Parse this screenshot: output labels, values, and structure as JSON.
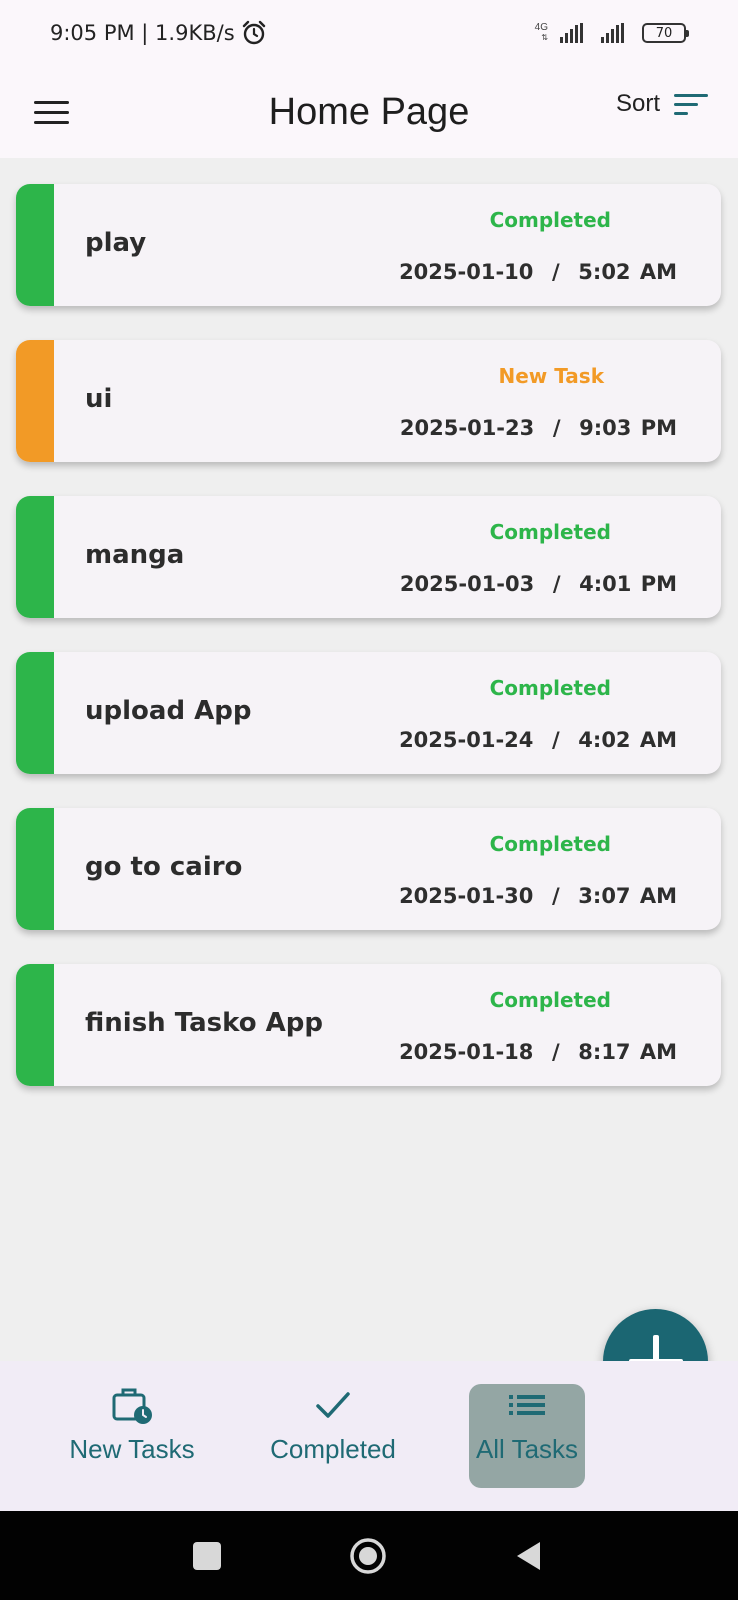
{
  "status_bar": {
    "time_speed": "9:05 PM | 1.9KB/s",
    "alarm_icon": "alarm-clock-icon",
    "network_type": "4G",
    "battery": "70"
  },
  "app_bar": {
    "title": "Home Page",
    "sort_label": "Sort",
    "menu_icon": "hamburger-menu-icon",
    "sort_icon": "sort-lines-icon"
  },
  "colors": {
    "completed": "#2db54a",
    "new_task": "#f29a26",
    "accent": "#1b6672"
  },
  "tasks": [
    {
      "title": "play",
      "status": "Completed",
      "datetime": "2025-01-10  /  5:02 AM",
      "status_type": "completed"
    },
    {
      "title": "ui",
      "status": "New Task",
      "datetime": "2025-01-23  /  9:03 PM",
      "status_type": "new"
    },
    {
      "title": "manga",
      "status": "Completed",
      "datetime": "2025-01-03  /  4:01 PM",
      "status_type": "completed"
    },
    {
      "title": "upload App",
      "status": "Completed",
      "datetime": "2025-01-24  /  4:02 AM",
      "status_type": "completed"
    },
    {
      "title": "go to cairo",
      "status": "Completed",
      "datetime": "2025-01-30  /  3:07 AM",
      "status_type": "completed"
    },
    {
      "title": "finish Tasko App",
      "status": "Completed",
      "datetime": "2025-01-18  /  8:17 AM",
      "status_type": "completed"
    }
  ],
  "fab": {
    "icon": "plus-icon"
  },
  "bottom_nav": {
    "items": [
      {
        "label": "New Tasks",
        "icon": "briefcase-clock-icon"
      },
      {
        "label": "Completed",
        "icon": "checkmark-icon"
      },
      {
        "label": "All Tasks",
        "icon": "list-icon",
        "active": true
      }
    ]
  },
  "system_nav": {
    "recents_icon": "square-icon",
    "home_icon": "circle-home-icon",
    "back_icon": "triangle-back-icon"
  }
}
